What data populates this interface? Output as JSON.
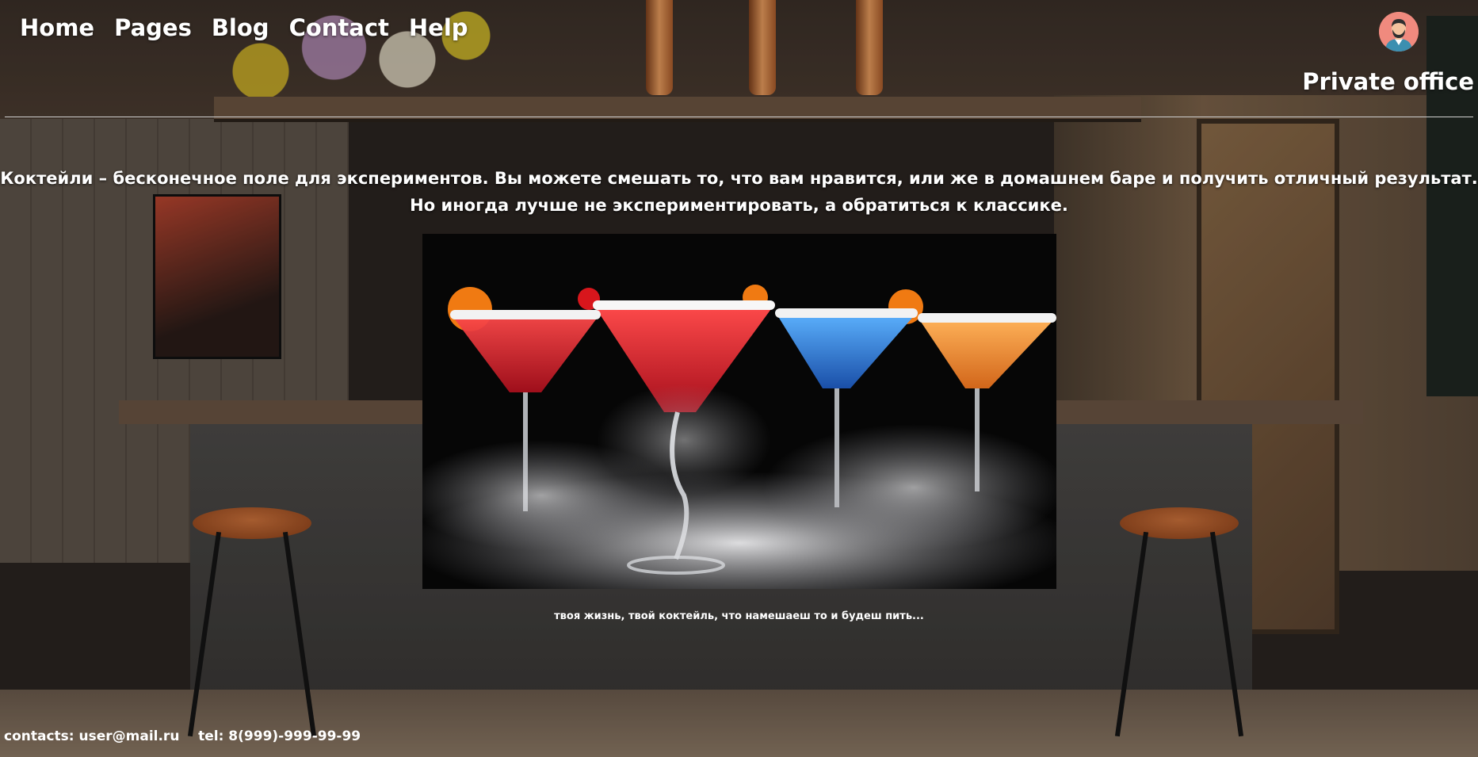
{
  "nav": {
    "items": [
      {
        "label": "Home"
      },
      {
        "label": "Pages"
      },
      {
        "label": "Blog"
      },
      {
        "label": "Contact"
      },
      {
        "label": "Help"
      }
    ]
  },
  "header": {
    "avatar_icon": "user-avatar-icon",
    "office_label": "Private office"
  },
  "main": {
    "intro_line1": "Коктейли – бесконечное поле для экспериментов. Вы можете смешать то, что вам нравится, или же в домашнем баре и получить отличный результат.",
    "intro_line2": "Но иногда лучше не экспериментировать, а обратиться к классике.",
    "caption": "твоя жизнь, твой коктейль, что намешаеш то и будеш пить..."
  },
  "footer": {
    "contacts": "contacts: user@mail.ru",
    "tel": "tel: 8(999)-999-99-99"
  },
  "colors": {
    "text": "#ffffff",
    "avatar_bg": "#f08a7e",
    "divider": "#cfcfcf"
  }
}
